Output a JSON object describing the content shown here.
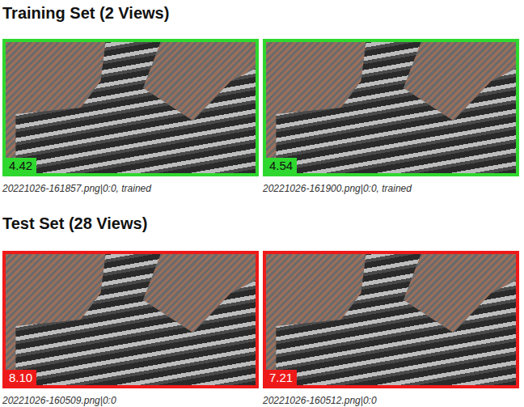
{
  "sections": [
    {
      "title": "Training Set (2 Views)",
      "kind": "pass",
      "color": "#2fd82f",
      "views": [
        {
          "score": "4.42",
          "caption": "20221026-161857.png|0:0, trained"
        },
        {
          "score": "4.54",
          "caption": "20221026-161900.png|0:0, trained"
        }
      ]
    },
    {
      "title": "Test Set (28 Views)",
      "kind": "fail",
      "color": "#ee1a1a",
      "views": [
        {
          "score": "8.10",
          "caption": "20221026-160509.png|0:0"
        },
        {
          "score": "7.21",
          "caption": "20221026-160512.png|0:0"
        }
      ]
    }
  ]
}
